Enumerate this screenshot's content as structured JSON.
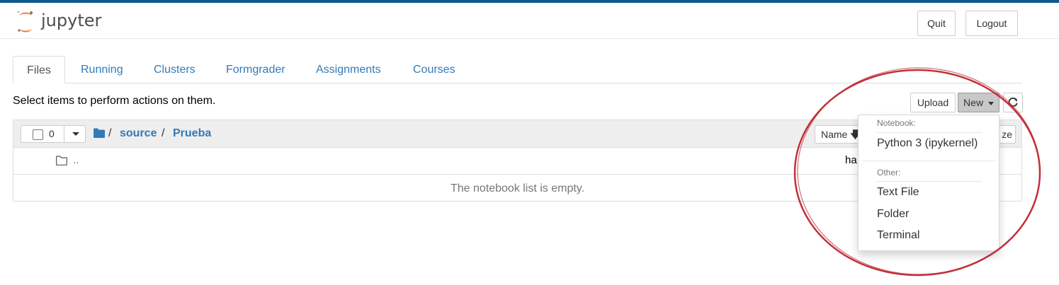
{
  "app": {
    "name": "jupyter"
  },
  "header": {
    "quit_label": "Quit",
    "logout_label": "Logout"
  },
  "tabs": [
    {
      "label": "Files"
    },
    {
      "label": "Running"
    },
    {
      "label": "Clusters"
    },
    {
      "label": "Formgrader"
    },
    {
      "label": "Assignments"
    },
    {
      "label": "Courses"
    }
  ],
  "toolbar": {
    "info_text": "Select items to perform actions on them.",
    "upload_label": "Upload",
    "new_label": "New"
  },
  "list": {
    "selected_count": "0",
    "breadcrumb": [
      "source",
      "Prueba"
    ],
    "sort_name_label": "Name",
    "sort_size_label": "ze",
    "parent_link": "..",
    "parent_modified": "ha",
    "empty_message": "The notebook list is empty."
  },
  "new_menu": {
    "notebook_header": "Notebook:",
    "notebook_item": "Python 3 (ipykernel)",
    "other_header": "Other:",
    "items": [
      "Text File",
      "Folder",
      "Terminal"
    ]
  },
  "colors": {
    "top_border": "#0e5a8a",
    "link": "#337ab7",
    "logo_orange": "#f37726",
    "annotation_circle": "#c0303a"
  }
}
